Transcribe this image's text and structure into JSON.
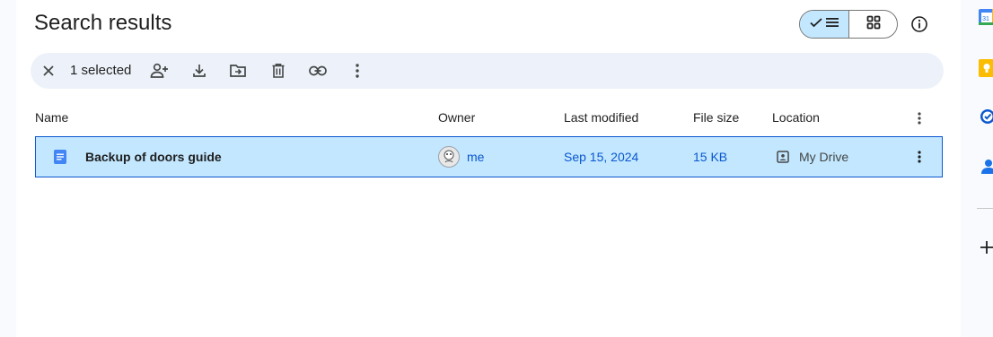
{
  "page": {
    "title": "Search results"
  },
  "view_toggle": {
    "list_icon": "list-view-icon",
    "grid_icon": "grid-view-icon",
    "active": "list"
  },
  "info_icon": "info-icon",
  "toolbar": {
    "selected_count": "1 selected",
    "icons": [
      "close-icon",
      "share-icon",
      "download-icon",
      "move-icon",
      "trash-icon",
      "link-icon",
      "more-vert-icon"
    ]
  },
  "table": {
    "headers": {
      "name": "Name",
      "owner": "Owner",
      "last_modified": "Last modified",
      "file_size": "File size",
      "location": "Location"
    },
    "rows": [
      {
        "name": "Backup of doors guide",
        "owner": "me",
        "last_modified": "Sep 15, 2024",
        "file_size": "15 KB",
        "location": "My Drive",
        "selected": true,
        "icon": "docs-icon"
      }
    ]
  },
  "side_panel": {
    "icons": [
      "calendar-icon",
      "keep-icon",
      "tasks-icon",
      "contacts-icon",
      "add-icon"
    ]
  },
  "colors": {
    "accent": "#0b57d0",
    "selected_bg": "#c2e7ff",
    "toolbar_bg": "#edf2fa",
    "docs_blue": "#4285f4"
  }
}
